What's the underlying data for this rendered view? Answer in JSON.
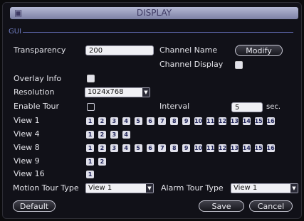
{
  "window": {
    "title": "DISPLAY",
    "icon": "window-icon"
  },
  "section": {
    "label": "GUI"
  },
  "fields": {
    "transparency": {
      "label": "Transparency",
      "value": "200"
    },
    "channel_name": {
      "label": "Channel Name",
      "button": "Modify"
    },
    "channel_display": {
      "label": "Channel Display",
      "checked": true
    },
    "overlay_info": {
      "label": "Overlay Info",
      "checked": true
    },
    "resolution": {
      "label": "Resolution",
      "value": "1024x768"
    },
    "enable_tour": {
      "label": "Enable Tour",
      "checked": false
    },
    "interval": {
      "label": "Interval",
      "value": "5",
      "unit": "sec."
    }
  },
  "views": [
    {
      "label": "View 1",
      "channels": [
        "1",
        "2",
        "3",
        "4",
        "5",
        "6",
        "7",
        "8",
        "9",
        "10",
        "11",
        "12",
        "13",
        "14",
        "15",
        "16"
      ]
    },
    {
      "label": "View 4",
      "channels": [
        "1",
        "2",
        "3",
        "4"
      ]
    },
    {
      "label": "View 8",
      "channels": [
        "1",
        "2",
        "3",
        "4",
        "5",
        "6",
        "7",
        "8",
        "9",
        "10",
        "11",
        "12",
        "13",
        "14",
        "15",
        "16"
      ]
    },
    {
      "label": "View 9",
      "channels": [
        "1",
        "2"
      ]
    },
    {
      "label": "View 16",
      "channels": [
        "1"
      ]
    }
  ],
  "tour_types": {
    "motion": {
      "label": "Motion Tour Type",
      "value": "View 1"
    },
    "alarm": {
      "label": "Alarm Tour Type",
      "value": "View 1"
    }
  },
  "buttons": {
    "default": "Default",
    "save": "Save",
    "cancel": "Cancel"
  },
  "colors": {
    "titlebar_top": "#b4b8d4",
    "titlebar_bottom": "#7d81a5",
    "section": "#6f7cc0",
    "background": "#111118"
  }
}
